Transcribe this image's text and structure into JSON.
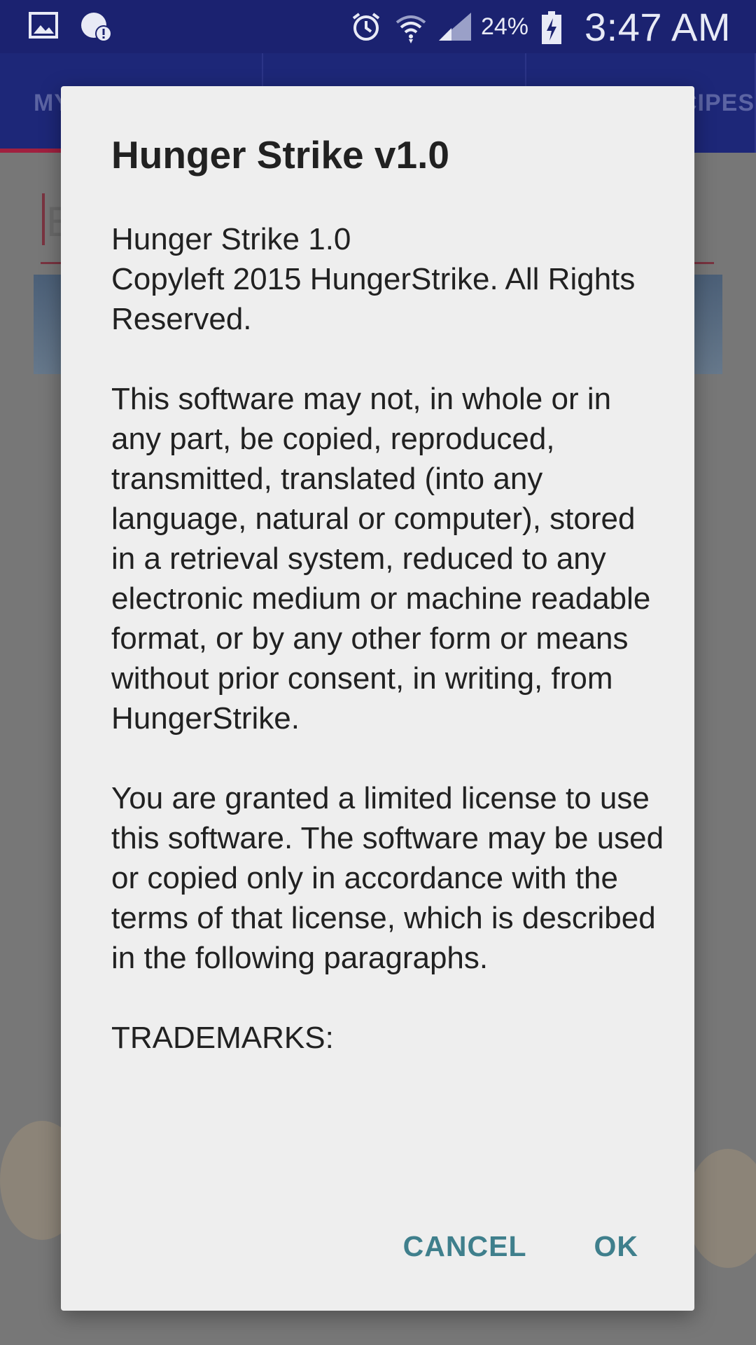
{
  "status_bar": {
    "battery_percent": "24%",
    "time": "3:47 AM",
    "icons": [
      "gallery-icon",
      "alert-icon",
      "alarm-icon",
      "wifi-icon",
      "signal-icon",
      "battery-charging-icon"
    ]
  },
  "app": {
    "tabs": [
      {
        "label": "MY"
      },
      {
        "label": ""
      },
      {
        "label": "ECIPES"
      }
    ],
    "search_ghost": "E"
  },
  "dialog": {
    "title": "Hunger Strike v1.0",
    "paragraphs": [
      "Hunger Strike 1.0\nCopyleft 2015 HungerStrike. All Rights Reserved.",
      "This software may not, in whole or in any part, be copied, reproduced, transmitted, translated (into any language, natural or computer), stored in a retrieval system, reduced to any electronic medium or machine readable format, or by any other form or means without prior consent, in writing, from HungerStrike.",
      "You are granted a limited license to use this software. The software may be used or copied only in accordance with the terms of that license, which is described in the following paragraphs.",
      "TRADEMARKS:"
    ],
    "cancel_label": "CANCEL",
    "ok_label": "OK"
  },
  "colors": {
    "status_bar": "#1b2270",
    "app_bar": "#1d2778",
    "accent": "#3f7f8c",
    "tab_indicator": "#a0203f",
    "dialog_bg": "#eeeeee"
  }
}
